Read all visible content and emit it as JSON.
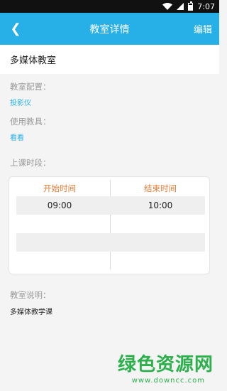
{
  "status_bar": {
    "time": "7:07"
  },
  "header": {
    "title": "教室详情",
    "back_icon": "chevron-left-icon",
    "edit_label": "编辑"
  },
  "classroom": {
    "name": "多媒体教室"
  },
  "config": {
    "label": "教室配置：",
    "value": "投影仪"
  },
  "tools": {
    "label": "使用教具：",
    "value": "看看"
  },
  "periods": {
    "label": "上课时段：",
    "start_header": "开始时间",
    "end_header": "结束时间",
    "rows": [
      {
        "start": "09:00",
        "end": "10:00"
      }
    ]
  },
  "description": {
    "label": "教室说明：",
    "value": "多媒体教学课"
  },
  "watermark": {
    "text": "绿色资源网",
    "url": "www.downcc.com"
  },
  "colors": {
    "accent": "#27b0e8",
    "header_text": "#e27b34",
    "watermark": "#2bb04c"
  }
}
